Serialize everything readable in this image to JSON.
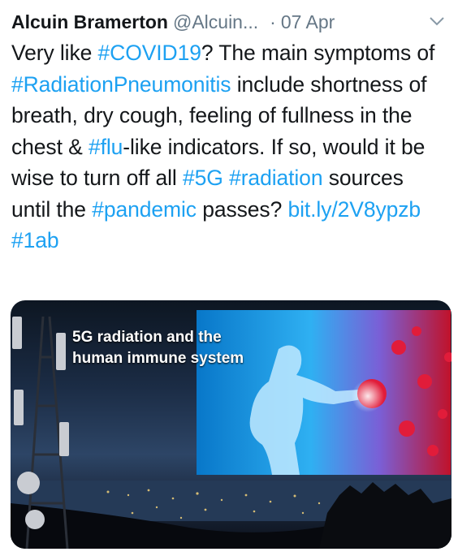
{
  "tweet": {
    "author_name": "Alcuin Bramerton",
    "author_handle": "@Alcuin...",
    "separator": "·",
    "date": "07 Apr",
    "body": [
      {
        "t": "Very like ",
        "link": false
      },
      {
        "t": "#COVID19",
        "link": true
      },
      {
        "t": "? The main symptoms of ",
        "link": false
      },
      {
        "t": "#RadiationPneumonitis",
        "link": true
      },
      {
        "t": " include shortness of breath, dry cough, feeling of fullness in the chest & ",
        "link": false
      },
      {
        "t": "#flu",
        "link": true
      },
      {
        "t": "-like indicators. If so, would it be wise to turn off all ",
        "link": false
      },
      {
        "t": "#5G",
        "link": true
      },
      {
        "t": " ",
        "link": false
      },
      {
        "t": "#radiation",
        "link": true
      },
      {
        "t": " sources until the ",
        "link": false
      },
      {
        "t": "#pandemic",
        "link": true
      },
      {
        "t": " passes?  ",
        "link": false
      },
      {
        "t": "bit.ly/2V8ypzb",
        "link": true
      },
      {
        "t": " ",
        "link": false
      },
      {
        "t": "#1ab",
        "link": true
      }
    ],
    "media": {
      "caption_line1": "5G radiation and the",
      "caption_line2": "human immune system"
    }
  },
  "colors": {
    "link": "#1da1f2",
    "muted": "#657786",
    "text": "#14171a"
  },
  "icons": {
    "menu": "chevron-down-icon"
  }
}
